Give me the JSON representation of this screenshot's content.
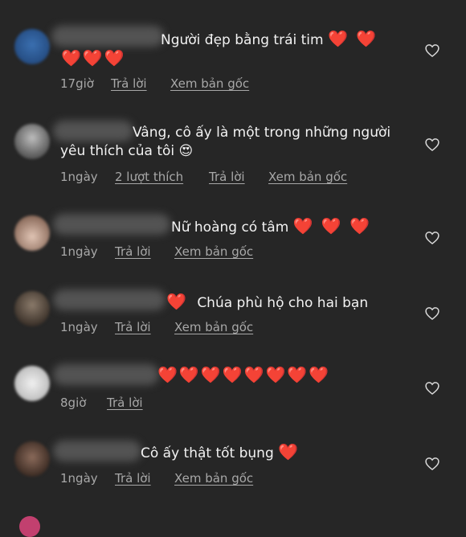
{
  "comments": [
    {
      "text": "Người đẹp bằng trái tim",
      "hearts_inline": "❤️ ❤️",
      "hearts_line2": "❤️❤️❤️",
      "time": "17giờ",
      "reply": "Trả lời",
      "view_original": "Xem bản gốc"
    },
    {
      "text_line1": "Vâng, cô ấy là một trong những người",
      "text_line2": "yêu thích của tôi",
      "emoji": "😍",
      "time": "1ngày",
      "likes": "2 lượt thích",
      "reply": "Trả lời",
      "view_original": "Xem bản gốc"
    },
    {
      "text": "Nữ hoàng có tâm",
      "hearts": "❤️ ❤️ ❤️",
      "time": "1ngày",
      "reply": "Trả lời",
      "view_original": "Xem bản gốc"
    },
    {
      "hearts": "❤️",
      "text": "Chúa phù hộ cho hai bạn",
      "time": "1ngày",
      "reply": "Trả lời",
      "view_original": "Xem bản gốc"
    },
    {
      "hearts": "❤️❤️❤️❤️❤️❤️❤️❤️",
      "time": "8giờ",
      "reply": "Trả lời"
    },
    {
      "text": "Cô ấy thật tốt bụng",
      "hearts": "❤️",
      "time": "1ngày",
      "reply": "Trả lời",
      "view_original": "Xem bản gốc"
    }
  ],
  "icons": {
    "like": "heart-outline-icon"
  },
  "colors": {
    "background": "#262626",
    "heart": "#ee2a2a",
    "meta": "#a8a8a8"
  }
}
